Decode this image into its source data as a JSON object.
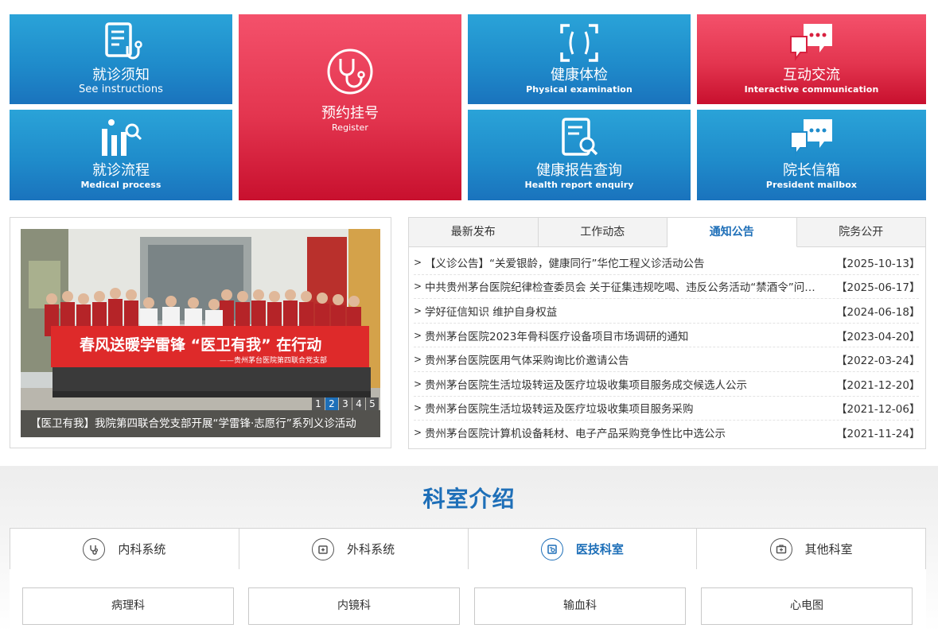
{
  "tiles": {
    "instructions": {
      "cn": "就诊须知",
      "en": "See instructions"
    },
    "register": {
      "cn": "预约挂号",
      "en": "Register"
    },
    "physical": {
      "cn": "健康体检",
      "en": "Physical examination"
    },
    "interactive": {
      "cn": "互动交流",
      "en": "Interactive communication"
    },
    "process": {
      "cn": "就诊流程",
      "en": "Medical process"
    },
    "report": {
      "cn": "健康报告查询",
      "en": "Health report enquiry"
    },
    "mailbox": {
      "cn": "院长信箱",
      "en": "President mailbox"
    }
  },
  "slider": {
    "caption": "【医卫有我】我院第四联合党支部开展“学雷锋·志愿行”系列义诊活动",
    "banner_main": "春风送暖学雷锋 “医卫有我” 在行动",
    "banner_sub": "——贵州茅台医院第四联合党支部",
    "pages": [
      "1",
      "2",
      "3",
      "4",
      "5"
    ],
    "active_page": 2
  },
  "news": {
    "tabs": [
      "最新发布",
      "工作动态",
      "通知公告",
      "院务公开"
    ],
    "active_tab": 2,
    "items": [
      {
        "title": "【义诊公告】“关爱银龄，健康同行”华佗工程义诊活动公告",
        "date": "【2025-10-13】"
      },
      {
        "title": "中共贵州茅台医院纪律检查委员会 关于征集违规吃喝、违反公务活动“禁酒令”问题线索的公告",
        "date": "【2025-06-17】"
      },
      {
        "title": "学好征信知识 维护自身权益",
        "date": "【2024-06-18】"
      },
      {
        "title": "贵州茅台医院2023年骨科医疗设备项目市场调研的通知",
        "date": "【2023-04-20】"
      },
      {
        "title": "贵州茅台医院医用气体采购询比价邀请公告",
        "date": "【2022-03-24】"
      },
      {
        "title": "贵州茅台医院生活垃圾转运及医疗垃圾收集项目服务成交候选人公示",
        "date": "【2021-12-20】"
      },
      {
        "title": "贵州茅台医院生活垃圾转运及医疗垃圾收集项目服务采购",
        "date": "【2021-12-06】"
      },
      {
        "title": "贵州茅台医院计算机设备耗材、电子产品采购竞争性比中选公示",
        "date": "【2021-11-24】"
      }
    ]
  },
  "departments": {
    "title": "科室介绍",
    "tabs": [
      {
        "label": "内科系统",
        "icon": "stethoscope-icon"
      },
      {
        "label": "外科系统",
        "icon": "medical-kit-icon"
      },
      {
        "label": "医技科室",
        "icon": "lab-icon"
      },
      {
        "label": "其他科室",
        "icon": "first-aid-icon"
      }
    ],
    "active_tab": 2,
    "items": [
      "病理科",
      "内镜科",
      "输血科",
      "心电图"
    ]
  },
  "colors": {
    "blue": "#1e6fb8",
    "tile_blue": "#1f8ccb",
    "tile_red": "#e3354f"
  }
}
